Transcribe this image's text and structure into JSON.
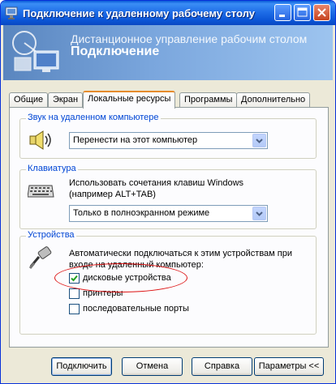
{
  "window": {
    "title": "Подключение к удаленному рабочему столу"
  },
  "banner": {
    "line1": "Дистанционное управление рабочим столом",
    "line2": "Подключение"
  },
  "tabs": [
    {
      "label": "Общие"
    },
    {
      "label": "Экран"
    },
    {
      "label": "Локальные ресурсы"
    },
    {
      "label": "Программы"
    },
    {
      "label": "Дополнительно"
    }
  ],
  "sound": {
    "group_label": "Звук на удаленном компьютере",
    "icon": "speaker-icon",
    "selected": "Перенести на этот компьютер"
  },
  "keyboard": {
    "group_label": "Клавиатура",
    "icon": "keyboard-icon",
    "desc_line1": "Использовать сочетания клавиш Windows",
    "desc_line2": "(например ALT+TAB)",
    "selected": "Только в полноэкранном режиме"
  },
  "devices": {
    "group_label": "Устройства",
    "icon": "plug-icon",
    "desc_line1": "Автоматически подключаться к этим устройствам при",
    "desc_line2": "входе на удаленный компьютер:",
    "items": [
      {
        "label": "дисковые устройства",
        "checked": true
      },
      {
        "label": "принтеры",
        "checked": false
      },
      {
        "label": "последовательные порты",
        "checked": false
      }
    ]
  },
  "buttons": {
    "connect": "Подключить",
    "cancel": "Отмена",
    "help": "Справка",
    "options": "Параметры <<"
  },
  "colors": {
    "title_bar": "#0b55d6",
    "group_label": "#0046d5",
    "annotation_ellipse": "#dd1111"
  }
}
